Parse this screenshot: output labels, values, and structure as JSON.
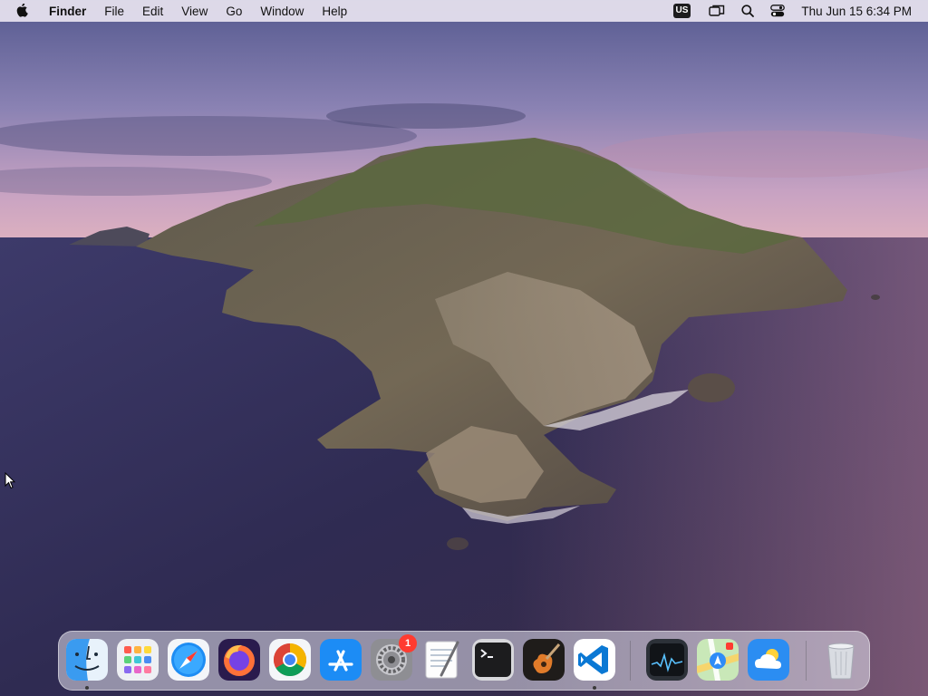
{
  "menubar": {
    "apple_icon": "apple-logo-icon",
    "app_name": "Finder",
    "menus": [
      "File",
      "Edit",
      "View",
      "Go",
      "Window",
      "Help"
    ],
    "keyboard_input": "US",
    "status_icons": [
      "screen-mirroring-icon",
      "spotlight-search-icon",
      "control-center-icon"
    ],
    "clock": "Thu Jun 15  6:34 PM"
  },
  "dock": {
    "apps": [
      {
        "name": "Finder",
        "icon": "finder-icon",
        "running": true
      },
      {
        "name": "Launchpad",
        "icon": "launchpad-icon",
        "running": false
      },
      {
        "name": "Safari",
        "icon": "safari-icon",
        "running": false
      },
      {
        "name": "Firefox",
        "icon": "firefox-icon",
        "running": false
      },
      {
        "name": "Google Chrome",
        "icon": "chrome-icon",
        "running": false
      },
      {
        "name": "App Store",
        "icon": "app-store-icon",
        "running": false
      },
      {
        "name": "System Preferences",
        "icon": "system-preferences-icon",
        "running": false,
        "badge": "1"
      },
      {
        "name": "TextEdit",
        "icon": "textedit-icon",
        "running": false
      },
      {
        "name": "Terminal",
        "icon": "terminal-icon",
        "running": false
      },
      {
        "name": "GarageBand",
        "icon": "garageband-icon",
        "running": false
      },
      {
        "name": "Visual Studio Code",
        "icon": "vscode-icon",
        "running": true
      },
      {
        "name": "Activity Monitor",
        "icon": "activity-monitor-icon",
        "running": false
      },
      {
        "name": "Maps",
        "icon": "maps-icon",
        "running": false
      },
      {
        "name": "Weather",
        "icon": "weather-icon",
        "running": false
      },
      {
        "name": "Trash",
        "icon": "trash-icon",
        "running": false
      }
    ]
  },
  "colors": {
    "badge": "#ff3b30",
    "vscode_blue": "#0a78d4",
    "finder_blue": "#3a9bf0"
  }
}
